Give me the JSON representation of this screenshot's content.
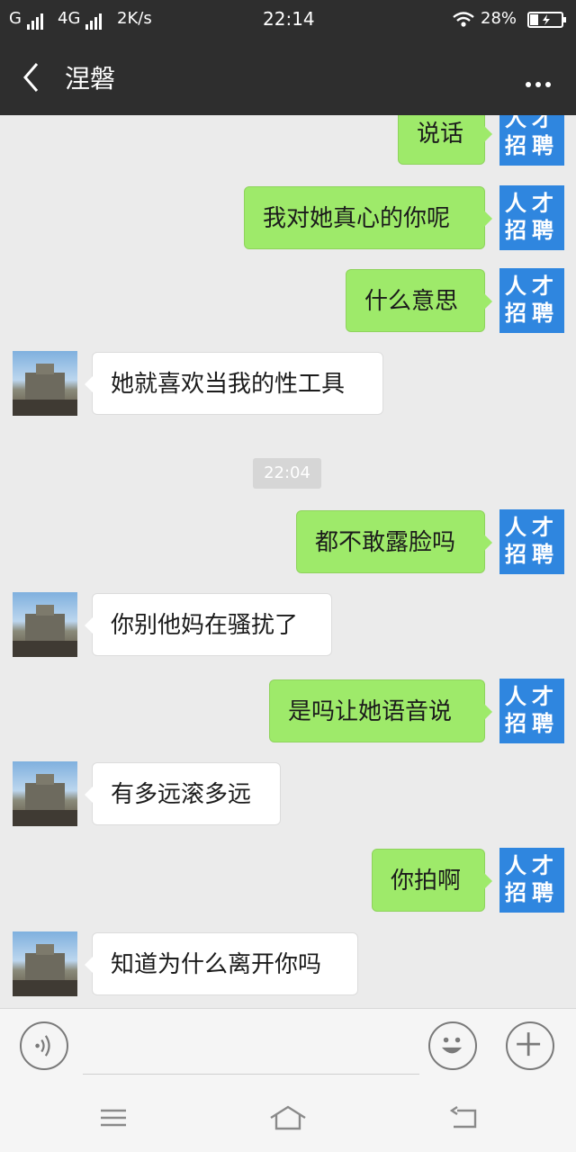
{
  "status_bar": {
    "carrier_1": "G",
    "carrier_2": "4G",
    "speed": "2K/s",
    "time": "22:14",
    "battery": "28%"
  },
  "header": {
    "title": "涅磐",
    "back_icon": "chevron-left-icon",
    "more_icon": "more-dots-icon"
  },
  "sender_avatar": {
    "line1": "人才",
    "line2": "招聘",
    "color": "#2f86df"
  },
  "messages": [
    {
      "side": "out",
      "text": "说话"
    },
    {
      "side": "out",
      "text": "我对她真心的你呢"
    },
    {
      "side": "out",
      "text": "什么意思"
    },
    {
      "side": "in",
      "text": "她就喜欢当我的性工具"
    },
    {
      "side": "out",
      "text": "都不敢露脸吗"
    },
    {
      "side": "in",
      "text": "你别他妈在骚扰了"
    },
    {
      "side": "out",
      "text": "是吗让她语音说"
    },
    {
      "side": "in",
      "text": "有多远滚多远"
    },
    {
      "side": "out",
      "text": "你拍啊"
    },
    {
      "side": "in",
      "text": "知道为什么离开你吗"
    }
  ],
  "timestamp": "22:04",
  "input_bar": {
    "voice_icon": "voice-icon",
    "emoji_icon": "emoji-icon",
    "plus_icon": "plus-icon",
    "value": ""
  },
  "nav_bar": {
    "menu_icon": "menu-icon",
    "home_icon": "home-icon",
    "back_icon": "back-icon"
  },
  "colors": {
    "outgoing_bubble": "#9eea6a",
    "incoming_bubble": "#ffffff",
    "header_bg": "#2e2e2e",
    "chat_bg": "#ebebeb"
  }
}
